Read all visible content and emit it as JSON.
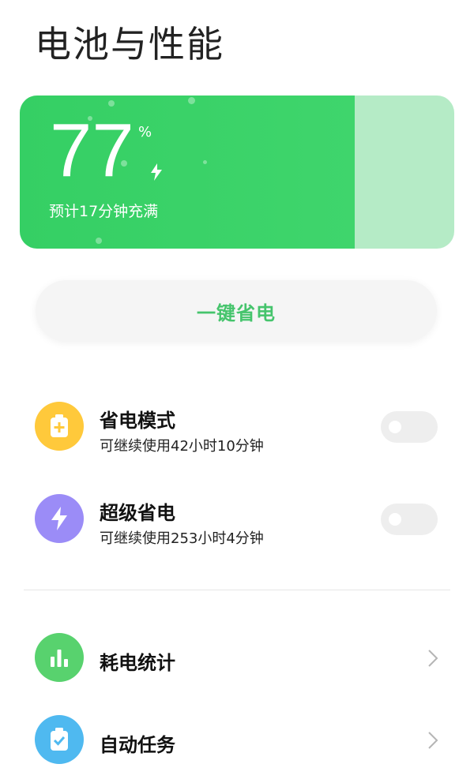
{
  "page": {
    "title": "电池与性能"
  },
  "battery": {
    "percent": "77",
    "percent_symbol": "%",
    "level": 0.77,
    "charging": true,
    "eta": "预计17分钟充满",
    "colors": {
      "fill": "#3fd56c",
      "track": "#b5ebc6"
    }
  },
  "save_button": {
    "label": "一键省电",
    "color": "#45c46c"
  },
  "modes": [
    {
      "title": "省电模式",
      "subtitle": "可继续使用42小时10分钟",
      "icon": "battery-plus-icon",
      "icon_color": "#ffc93b",
      "enabled": false
    },
    {
      "title": "超级省电",
      "subtitle": "可继续使用253小时4分钟",
      "icon": "bolt-icon",
      "icon_color": "#9b8cf7",
      "enabled": false
    }
  ],
  "links": [
    {
      "title": "耗电统计",
      "icon": "bar-chart-icon",
      "icon_color": "#58d26e"
    },
    {
      "title": "自动任务",
      "icon": "clipboard-check-icon",
      "icon_color": "#4fb9f0"
    }
  ]
}
